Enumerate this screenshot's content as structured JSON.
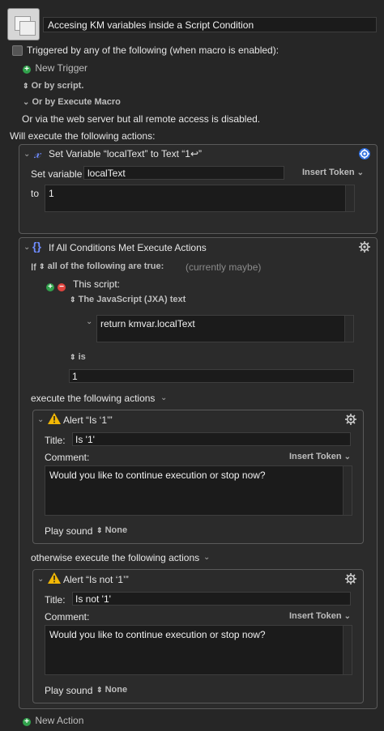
{
  "header": {
    "macro_name": "Accesing KM variables inside a Script Condition"
  },
  "triggers": {
    "heading": "Triggered by any of the following (when macro is enabled):",
    "new_trigger": "New Trigger",
    "by_script": "Or by script.",
    "by_execute_macro": "Or by Execute Macro",
    "web_server_note": "Or via the web server but all remote access is disabled."
  },
  "will_execute": "Will execute the following actions:",
  "action1": {
    "title": "Set Variable “localText” to Text “1↩”",
    "set_variable_label": "Set variable",
    "variable_name": "localText",
    "insert_token": "Insert Token",
    "to_label": "to",
    "value": "1"
  },
  "action2": {
    "title": "If All Conditions Met Execute Actions",
    "if_label": "If",
    "all_following": "all of the following are true:",
    "currently": "(currently maybe)",
    "this_script": "This script:",
    "script_type": "The JavaScript (JXA) text",
    "script_text": "return kmvar.localText",
    "is_label": "is",
    "is_value": "1",
    "execute_label": "execute the following actions",
    "otherwise_label": "otherwise execute the following actions"
  },
  "alert1": {
    "title": "Alert “Is ‘1’”",
    "title_label": "Title:",
    "title_value": "Is '1'",
    "comment_label": "Comment:",
    "insert_token": "Insert Token",
    "comment": "Would you like to continue execution or stop now?",
    "play_sound_label": "Play sound",
    "play_sound_value": "None"
  },
  "alert2": {
    "title": "Alert “Is not ‘1’”",
    "title_label": "Title:",
    "title_value": "Is not '1'",
    "comment_label": "Comment:",
    "insert_token": "Insert Token",
    "comment": "Would you like to continue execution or stop now?",
    "play_sound_label": "Play sound",
    "play_sound_value": "None"
  },
  "footer": {
    "new_action": "New Action"
  },
  "colors": {
    "background": "#262626",
    "accent": "#3b82f6",
    "add": "#31a24c",
    "remove": "#e0443e",
    "warning": "#f2b705"
  }
}
